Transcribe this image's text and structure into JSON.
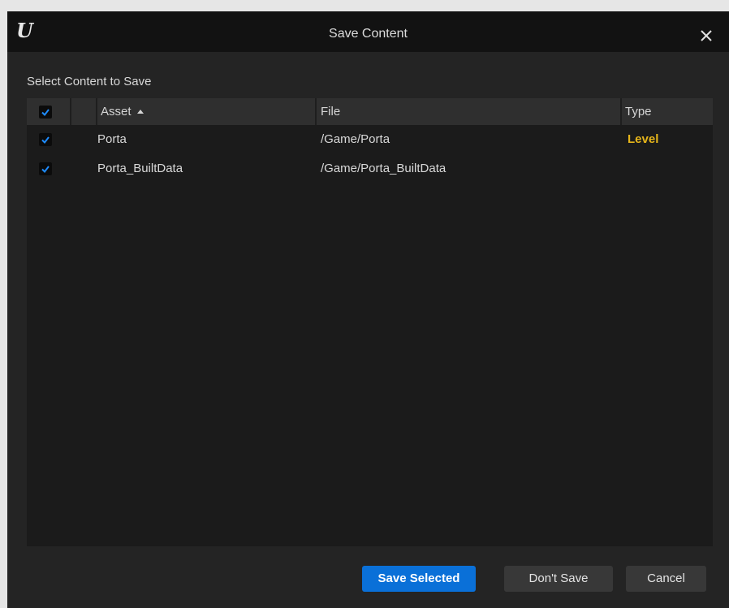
{
  "window": {
    "title": "Save Content",
    "logo_text": "U"
  },
  "section_label": "Select Content to Save",
  "table": {
    "header_checked": true,
    "columns": {
      "asset": "Asset",
      "file": "File",
      "type": "Type"
    },
    "sort": {
      "column": "Asset",
      "direction": "ascending"
    },
    "rows": [
      {
        "checked": true,
        "asset": "Porta",
        "file": "/Game/Porta",
        "type": "Level"
      },
      {
        "checked": true,
        "asset": "Porta_BuiltData",
        "file": "/Game/Porta_BuiltData",
        "type": ""
      }
    ]
  },
  "buttons": {
    "save_selected": "Save Selected",
    "dont_save": "Don't Save",
    "cancel": "Cancel"
  },
  "colors": {
    "accent": "#0a70d8",
    "checkmark": "#1e8cff",
    "type_level": "#e6b51a"
  },
  "icons": {
    "logo": "unreal-engine-icon",
    "close": "close-icon",
    "sort": "sort-ascending-icon",
    "check": "checkmark-icon"
  }
}
